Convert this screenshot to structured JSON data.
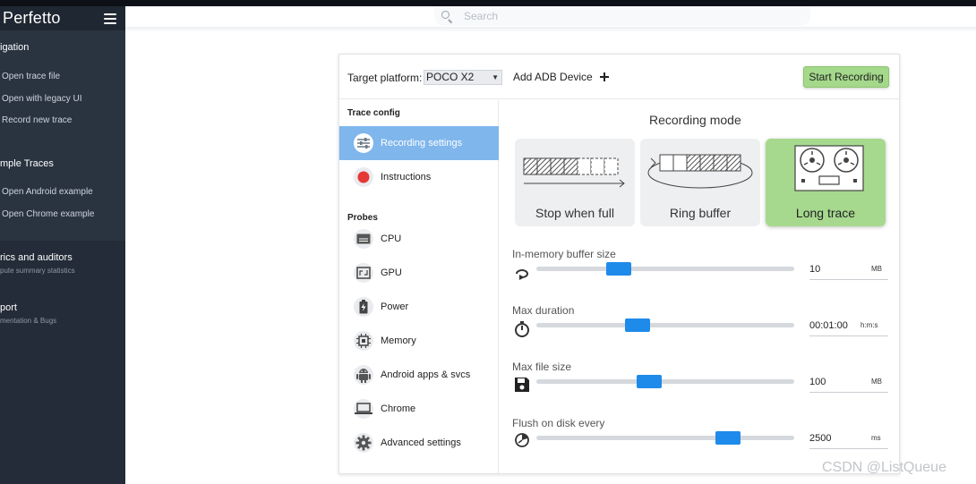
{
  "sidebar": {
    "title": "Perfetto",
    "sections": [
      {
        "title": "igation",
        "items": [
          "Open trace file",
          "Open with legacy UI",
          "Record new trace"
        ]
      },
      {
        "title": "mple Traces",
        "items": [
          "Open Android example",
          "Open Chrome example"
        ]
      },
      {
        "title": "rics and auditors",
        "subtitle": "pute summary statistics"
      },
      {
        "title": "port",
        "subtitle": "mentation & Bugs"
      }
    ]
  },
  "search": {
    "placeholder": "Search"
  },
  "record": {
    "target_label": "Target platform:",
    "target_value": "POCO X2",
    "add_adb": "Add ADB Device",
    "start_button": "Start Recording",
    "nav": {
      "trace_config_heading": "Trace config",
      "probes_heading": "Probes",
      "items": [
        "Recording settings",
        "Instructions",
        "CPU",
        "GPU",
        "Power",
        "Memory",
        "Android apps & svcs",
        "Chrome",
        "Advanced settings"
      ]
    },
    "recording_mode": {
      "title": "Recording mode",
      "modes": [
        "Stop when full",
        "Ring buffer",
        "Long trace"
      ],
      "selected": "Long trace"
    },
    "sliders": [
      {
        "label": "In-memory buffer size",
        "value": "10",
        "unit": "MB",
        "fraction": 0.3
      },
      {
        "label": "Max duration",
        "value": "00:01:00",
        "unit": "h:m:s",
        "fraction": 0.38
      },
      {
        "label": "Max file size",
        "value": "100",
        "unit": "MB",
        "fraction": 0.43
      },
      {
        "label": "Flush on disk every",
        "value": "2500",
        "unit": "ms",
        "fraction": 0.77
      }
    ]
  },
  "colors": {
    "accent": "#1e8bea",
    "selected_mode": "#a6d98e",
    "active_nav": "#7fb6ec",
    "sidebar": "#2a3441",
    "record_dot": "#e53935"
  },
  "watermark": "CSDN @ListQueue"
}
